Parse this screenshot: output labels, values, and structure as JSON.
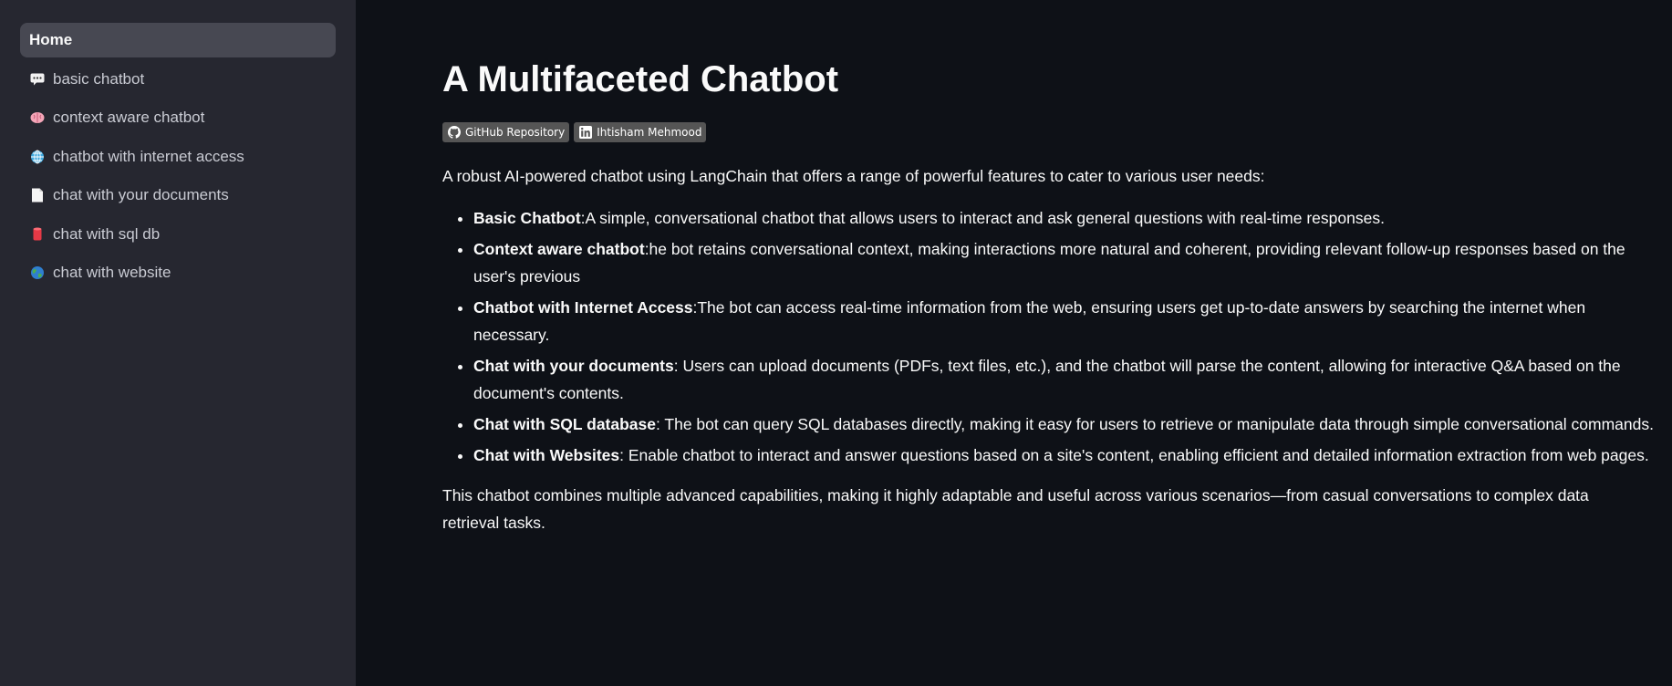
{
  "sidebar": {
    "items": [
      {
        "label": "Home",
        "icon": "none",
        "active": true
      },
      {
        "label": "basic chatbot",
        "icon": "speech-bubble-icon",
        "active": false
      },
      {
        "label": "context aware chatbot",
        "icon": "brain-icon",
        "active": false
      },
      {
        "label": "chatbot with internet access",
        "icon": "globe-meridians-icon",
        "active": false
      },
      {
        "label": "chat with your documents",
        "icon": "document-icon",
        "active": false
      },
      {
        "label": "chat with sql db",
        "icon": "database-icon",
        "active": false
      },
      {
        "label": "chat with website",
        "icon": "earth-icon",
        "active": false
      }
    ]
  },
  "main": {
    "title": "A Multifaceted Chatbot",
    "badges": [
      {
        "label": "GitHub Repository",
        "icon": "github-icon"
      },
      {
        "label": "Ihtisham Mehmood",
        "icon": "linkedin-icon"
      }
    ],
    "intro": "A robust AI-powered chatbot using LangChain that offers a range of powerful features to cater to various user needs:",
    "features": [
      {
        "name": "Basic Chatbot",
        "text": ":A simple, conversational chatbot that allows users to interact and ask general questions with real-time responses."
      },
      {
        "name": "Context aware chatbot",
        "text": ":he bot retains conversational context, making interactions more natural and coherent, providing relevant follow-up responses based on the user's previous"
      },
      {
        "name": "Chatbot with Internet Access",
        "text": ":The bot can access real-time information from the web, ensuring users get up-to-date answers by searching the internet when necessary."
      },
      {
        "name": "Chat with your documents",
        "text": ": Users can upload documents (PDFs, text files, etc.), and the chatbot will parse the content, allowing for interactive Q&A based on the document's contents."
      },
      {
        "name": "Chat with SQL database",
        "text": ": The bot can query SQL databases directly, making it easy for users to retrieve or manipulate data through simple conversational commands."
      },
      {
        "name": "Chat with Websites",
        "text": ": Enable chatbot to interact and answer questions based on a site's content, enabling efficient and detailed information extraction from web pages."
      }
    ],
    "outro": "This chatbot combines multiple advanced capabilities, making it highly adaptable and useful across various scenarios—from casual conversations to complex data retrieval tasks."
  },
  "colors": {
    "background": "#0e1117",
    "sidebar": "#262730",
    "active_item": "#474852",
    "badge": "#555555",
    "text": "#fafafa"
  }
}
